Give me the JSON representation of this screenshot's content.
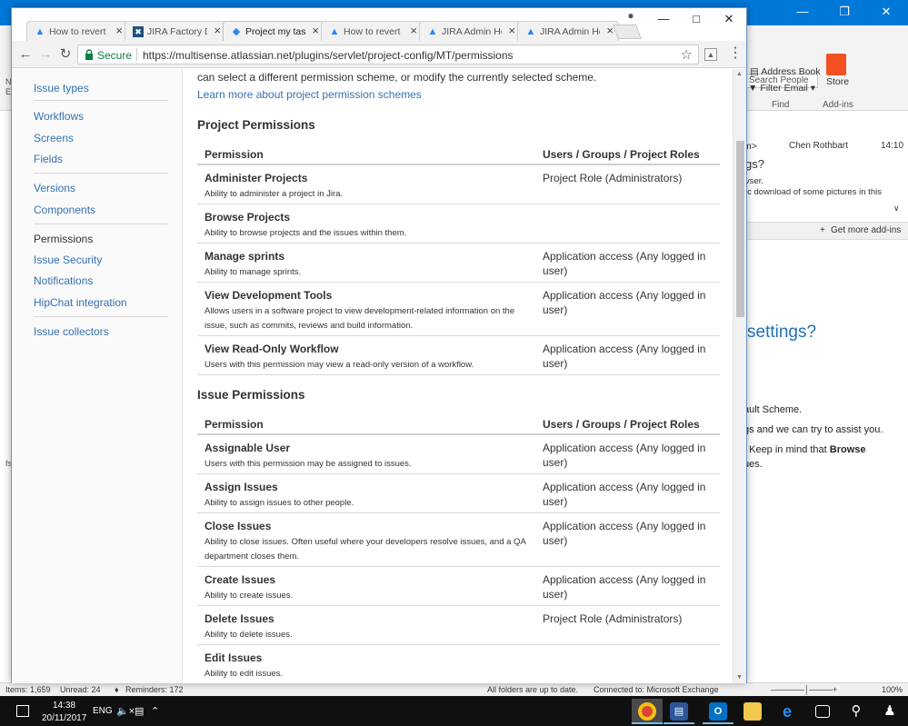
{
  "outlook": {
    "ribbon": {
      "search_people": "Search People",
      "address_book": "Address Book",
      "filter_email": "Filter Email",
      "store": "Store",
      "group_find": "Find",
      "group_addins": "Add-ins"
    },
    "reading_pane": {
      "header_tail": "m>",
      "sender": "Chen Rothbart",
      "time": "14:10",
      "subject_tail": "gs?",
      "line1": "vser.",
      "line2": "ic download of some pictures in this",
      "get_more_addins": "Get more add-ins",
      "settings_heading": "settings?",
      "body_line1": "ault Scheme.",
      "body_line2": "gs and we can try to assist you.",
      "body_line3_a": ". Keep in mind that ",
      "body_line3_b": "Browse",
      "body_line4": "ues."
    },
    "left_edge": [
      "N",
      "E",
      "fs"
    ],
    "status": {
      "items": "Items: 1,659",
      "unread": "Unread: 24",
      "reminders": "Reminders: 172",
      "folders": "All folders are up to date.",
      "connection": "Connected to: Microsoft Exchange",
      "zoom": "100%"
    }
  },
  "browser": {
    "tabs": [
      {
        "title": "How to revert",
        "icon": "atlassian"
      },
      {
        "title": "JIRA Factory D",
        "icon": "jira-factory"
      },
      {
        "title": "Project my tas",
        "icon": "jira",
        "active": true
      },
      {
        "title": "How to revert",
        "icon": "atlassian"
      },
      {
        "title": "JIRA Admin He",
        "icon": "atlassian"
      },
      {
        "title": "JIRA Admin He",
        "icon": "atlassian"
      }
    ],
    "secure_label": "Secure",
    "url": "https://multisense.atlassian.net/plugins/servlet/project-config/MT/permissions"
  },
  "sidebar": {
    "items": [
      "Issue types",
      "Workflows",
      "Screens",
      "Fields",
      "Versions",
      "Components",
      "Permissions",
      "Issue Security",
      "Notifications",
      "HipChat integration",
      "Issue collectors"
    ],
    "selected": "Permissions"
  },
  "main": {
    "intro_text": "can select a different permission scheme, or modify the currently selected scheme.",
    "learn_more": "Learn more about project permission schemes",
    "col_permission": "Permission",
    "col_roles": "Users / Groups / Project Roles",
    "project_heading": "Project Permissions",
    "project_permissions": [
      {
        "name": "Administer Projects",
        "desc": "Ability to administer a project in Jira.",
        "roles": "Project Role (Administrators)"
      },
      {
        "name": "Browse Projects",
        "desc": "Ability to browse projects and the issues within them.",
        "roles": ""
      },
      {
        "name": "Manage sprints",
        "desc": "Ability to manage sprints.",
        "roles": "Application access (Any logged in user)"
      },
      {
        "name": "View Development Tools",
        "desc": "Allows users in a software project to view development-related information on the issue, such as commits, reviews and build information.",
        "roles": "Application access (Any logged in user)"
      },
      {
        "name": "View Read-Only Workflow",
        "desc": "Users with this permission may view a read-only version of a workflow.",
        "roles": "Application access (Any logged in user)"
      }
    ],
    "issue_heading": "Issue Permissions",
    "issue_permissions": [
      {
        "name": "Assignable User",
        "desc": "Users with this permission may be assigned to issues.",
        "roles": "Application access (Any logged in user)"
      },
      {
        "name": "Assign Issues",
        "desc": "Ability to assign issues to other people.",
        "roles": "Application access (Any logged in user)"
      },
      {
        "name": "Close Issues",
        "desc": "Ability to close issues. Often useful where your developers resolve issues, and a QA department closes them.",
        "roles": "Application access (Any logged in user)"
      },
      {
        "name": "Create Issues",
        "desc": "Ability to create issues.",
        "roles": "Application access (Any logged in user)"
      },
      {
        "name": "Delete Issues",
        "desc": "Ability to delete issues.",
        "roles": "Project Role (Administrators)"
      },
      {
        "name": "Edit Issues",
        "desc": "Ability to edit issues.",
        "roles": ""
      }
    ]
  },
  "taskbar": {
    "time": "14:38",
    "date": "20/11/2017",
    "language": "ENG",
    "apps": [
      {
        "name": "chrome",
        "label": "",
        "color": "#db4437"
      },
      {
        "name": "news",
        "label": "",
        "color": "#2b579a"
      },
      {
        "name": "outlook",
        "label": "O",
        "color": "#0072c6"
      },
      {
        "name": "file-explorer",
        "label": "",
        "color": "#f2c94c"
      },
      {
        "name": "edge",
        "label": "e",
        "color": "#1e90ff"
      },
      {
        "name": "task-view",
        "label": "",
        "color": "#555555"
      },
      {
        "name": "search",
        "label": "",
        "color": "#555555"
      },
      {
        "name": "people",
        "label": "",
        "color": "#555555"
      }
    ]
  },
  "colors": {
    "link": "#3572b0",
    "secure": "#0b8043",
    "taskbar": "#101010",
    "desktop": "#0078d7"
  }
}
